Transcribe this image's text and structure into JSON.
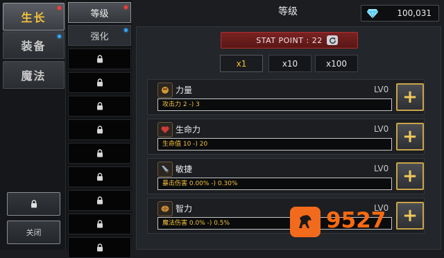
{
  "categories": [
    {
      "label": "生长",
      "active": true,
      "dot": "red"
    },
    {
      "label": "装备",
      "active": false,
      "dot": "blue"
    },
    {
      "label": "魔法",
      "active": false,
      "dot": ""
    }
  ],
  "bottom": {
    "close_label": "关闭"
  },
  "subtabs": [
    {
      "label": "等级",
      "active": true,
      "dot": "red"
    },
    {
      "label": "强化",
      "active": false,
      "dot": "blue"
    }
  ],
  "locked_slot_count": 9,
  "header": {
    "title": "等级"
  },
  "currency": {
    "amount": "100,031"
  },
  "stat_point": {
    "label": "STAT POINT : 22"
  },
  "multipliers": [
    {
      "label": "x1",
      "active": true
    },
    {
      "label": "x10",
      "active": false
    },
    {
      "label": "x100",
      "active": false
    }
  ],
  "stats": [
    {
      "name": "力量",
      "level": "LV0",
      "effect": "攻击力 2 -) 3",
      "icon": "fist-icon"
    },
    {
      "name": "生命力",
      "level": "LV0",
      "effect": "生命值 10 -) 20",
      "icon": "heart-icon"
    },
    {
      "name": "敏捷",
      "level": "LV0",
      "effect": "暴击伤害 0.00% -) 0.30%",
      "icon": "dagger-icon"
    },
    {
      "name": "智力",
      "level": "LV0",
      "effect": "魔法伤害 0.0% -) 0.5%",
      "icon": "brain-icon"
    }
  ],
  "watermark": {
    "text": "9527"
  },
  "colors": {
    "accent_gold": "#f3c23a",
    "stat_point_red": "#7a2222",
    "dot_red": "#ff3b3b",
    "dot_blue": "#33a8ff"
  }
}
